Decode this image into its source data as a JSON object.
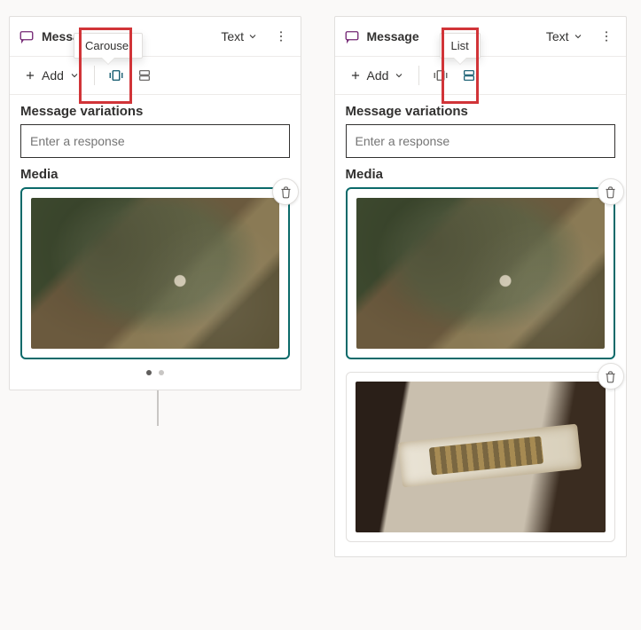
{
  "left": {
    "title": "Message",
    "tooltip": "Carousel",
    "textDropdown": "Text",
    "addLabel": "Add",
    "sections": {
      "variations": "Message variations",
      "media": "Media"
    },
    "responsePlaceholder": "Enter a response"
  },
  "right": {
    "title": "Message",
    "tooltip": "List",
    "textDropdown": "Text",
    "addLabel": "Add",
    "sections": {
      "variations": "Message variations",
      "media": "Media"
    },
    "responsePlaceholder": "Enter a response"
  }
}
